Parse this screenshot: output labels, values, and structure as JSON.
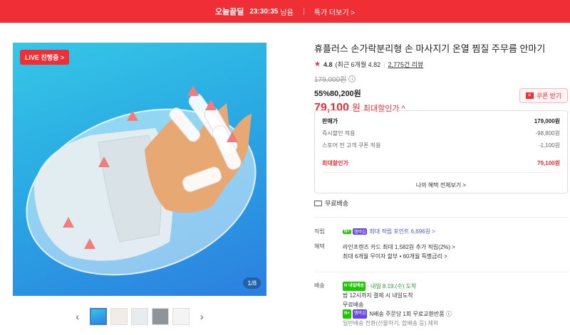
{
  "topbar": {
    "brand": "오늘끝딜",
    "time": "23:30:35",
    "remaining": "남음",
    "more": "특가 더보기 >"
  },
  "gallery": {
    "live_badge": "LIVE 진행중 >",
    "counter": "1/8",
    "prev": "‹",
    "next": "›"
  },
  "product": {
    "title": "휴플러스 손가락분리형 손 마사지기 온열 찜질 주무름 안마기",
    "rating": "4.8",
    "rating_detail": "(최근 6개월 4.82",
    "reviews": "2,775건 리뷰",
    "original_price": "179,000원",
    "discount_pct": "55%",
    "discount_price": "80,200원",
    "max_price": "79,100",
    "max_price_unit": "원",
    "max_label": "최대할인가 ^",
    "coupon_label": "쿠폰 받기"
  },
  "pricebox": {
    "rows": [
      {
        "label": "판매가",
        "value": "179,000원"
      },
      {
        "label": "즉시할인 적용",
        "value": "-98,800원"
      },
      {
        "label": "스토어 전 고객 쿠폰 적용",
        "value": "-1,100원"
      }
    ],
    "final_label": "최대할인가",
    "final_value": "79,100원",
    "benefit_link": "나의 혜택 전체보기 >"
  },
  "shipping_tag": "무료배송",
  "points": {
    "label": "적립",
    "pill_n": "N+",
    "pill_m": "멤버십",
    "text": "최대 적립 포인트 6,696원 >"
  },
  "benefits": {
    "label": "혜택",
    "line1": "라인프렌즈 카드 최대 1,582원 추가 적립(2%) >",
    "line2": "최대 6개월 무이자 할부 • 60개월 특별금리 >"
  },
  "delivery": {
    "label": "배송",
    "pill": "N 내일배송",
    "line1": "· 내일 8.19.(수) 도착",
    "line2": "밤 12시까지 결제 시 내일도착",
    "line3": "무료배송",
    "line4": "N배송 주문당 1회 무료교환반품 ⓘ",
    "line5": "일반배송 전환(선물하기, 합배송 등) 제외"
  },
  "colors": {
    "accent": "#ef2f35",
    "image_bg_top": "#35c7e6",
    "image_bg_bottom": "#2c7fe0",
    "naver_green": "#1ec800"
  }
}
